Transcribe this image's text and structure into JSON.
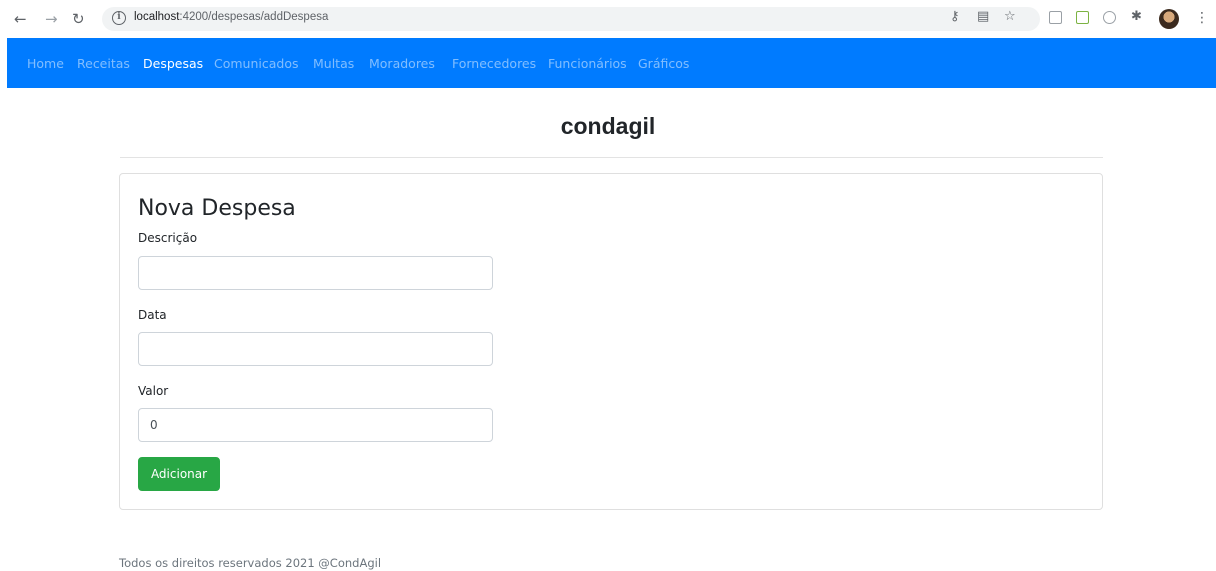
{
  "browser": {
    "url_host": "localhost",
    "url_path": ":4200/despesas/addDespesa",
    "icons": [
      "back-icon",
      "forward-icon",
      "reload-icon",
      "info-icon",
      "key-icon",
      "translate-icon",
      "star-icon",
      "extension-icon",
      "profile-avatar",
      "menu-icon"
    ]
  },
  "navbar": {
    "items": [
      {
        "label": "Home",
        "active": false
      },
      {
        "label": "Receitas",
        "active": false
      },
      {
        "label": "Despesas",
        "active": true
      },
      {
        "label": "Comunicados",
        "active": false
      },
      {
        "label": "Multas",
        "active": false
      },
      {
        "label": "Moradores",
        "active": false
      },
      {
        "label": "Fornecedores",
        "active": false
      },
      {
        "label": "Funcionários",
        "active": false
      },
      {
        "label": "Gráficos",
        "active": false
      }
    ],
    "color": "#007bff"
  },
  "header": {
    "brand": "condagil"
  },
  "form": {
    "title": "Nova Despesa",
    "fields": [
      {
        "label": "Descrição",
        "value": ""
      },
      {
        "label": "Data",
        "value": ""
      },
      {
        "label": "Valor",
        "value": "0"
      }
    ],
    "submit_label": "Adicionar",
    "submit_color": "#28a745"
  },
  "footer": {
    "text": "Todos os direitos reservados 2021 @CondAgil"
  }
}
